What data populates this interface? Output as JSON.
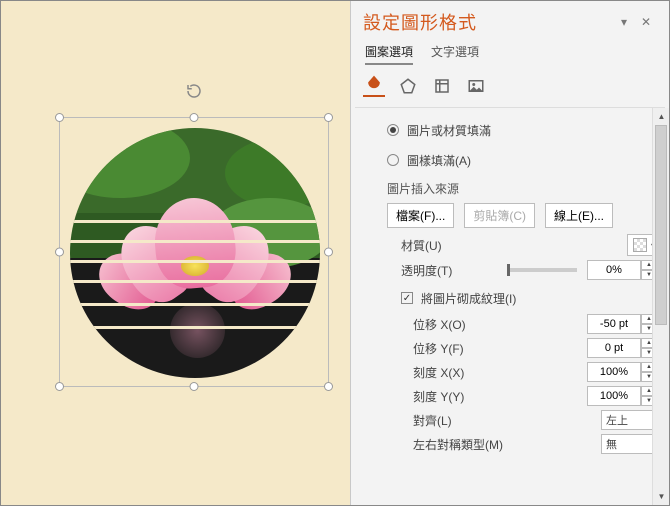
{
  "panel": {
    "title": "設定圖形格式",
    "tabs_text": {
      "shape_options": "圖案選項",
      "text_options": "文字選項"
    },
    "radios": {
      "picture_fill_truncated": "圖片或材質填滿",
      "pattern_fill": "圖樣填滿(A)"
    },
    "picture_source_label": "圖片插入來源",
    "buttons": {
      "file": "檔案(F)...",
      "clipboard": "剪貼簿(C)",
      "online": "線上(E)..."
    },
    "texture_label": "材質(U)",
    "transparency": {
      "label": "透明度(T)",
      "value": "0%"
    },
    "tile_checkbox": "將圖片砌成紋理(I)",
    "offset_x": {
      "label": "位移 X(O)",
      "value": "-50 pt"
    },
    "offset_y": {
      "label": "位移 Y(F)",
      "value": "0 pt"
    },
    "scale_x": {
      "label": "刻度 X(X)",
      "value": "100%"
    },
    "scale_y": {
      "label": "刻度 Y(Y)",
      "value": "100%"
    },
    "alignment": {
      "label": "對齊(L)",
      "value": "左上"
    },
    "mirror": {
      "label": "左右對稱類型(M)",
      "value": "無"
    }
  }
}
